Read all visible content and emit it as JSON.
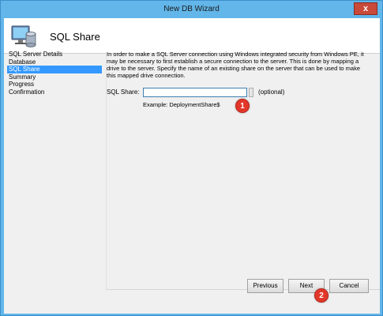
{
  "window": {
    "title": "New DB Wizard",
    "close_label": "x"
  },
  "header": {
    "title": "SQL Share"
  },
  "nav": {
    "items": [
      {
        "label": "SQL Server Details"
      },
      {
        "label": "Database"
      },
      {
        "label": "SQL Share"
      },
      {
        "label": "Summary"
      },
      {
        "label": "Progress"
      },
      {
        "label": "Confirmation"
      }
    ],
    "selected": "SQL Share"
  },
  "content": {
    "description": "In order to make a SQL Server connection using Windows integrated security from Windows PE, it may be necessary to first establish a secure connection to the server. This is done by mapping a drive to the server. Specify the name of an existing share on the server that can be used to make this mapped drive connection.",
    "share_label": "SQL Share:",
    "share_value": "",
    "share_note": "(optional)",
    "example": "Example:  DeploymentShare$"
  },
  "badges": {
    "first": "1",
    "second": "2"
  },
  "buttons": {
    "previous": "Previous",
    "next": "Next",
    "cancel": "Cancel"
  },
  "colors": {
    "titlebar": "#62b6e9",
    "selection": "#3399ff",
    "badge": "#e2372a",
    "close": "#c94a3a"
  }
}
